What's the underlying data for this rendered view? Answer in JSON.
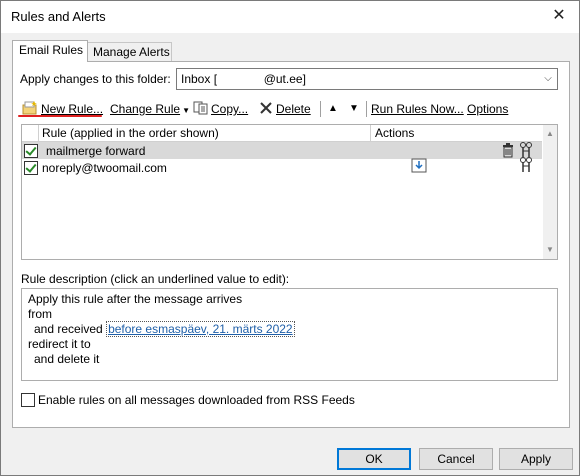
{
  "window": {
    "title": "Rules and Alerts",
    "close_glyph": "✕"
  },
  "tabs": [
    {
      "label": "Email Rules",
      "active": true
    },
    {
      "label": "Manage Alerts",
      "active": false
    }
  ],
  "folder": {
    "label": "Apply changes to this folder:",
    "value": "Inbox [              @ut.ee]"
  },
  "toolbar": {
    "new_rule": "New Rule...",
    "change_rule": "Change Rule",
    "copy": "Copy...",
    "delete": "Delete",
    "run_rules": "Run Rules Now...",
    "options": "Options"
  },
  "rules_table": {
    "columns": [
      "Rule (applied in the order shown)",
      "Actions"
    ],
    "rows": [
      {
        "name": "mailmerge forward",
        "enabled": true,
        "selected": true
      },
      {
        "name": "noreply@twoomail.com",
        "enabled": true,
        "selected": false
      }
    ]
  },
  "description": {
    "label": "Rule description (click an underlined value to edit):",
    "line1": "Apply this rule after the message arrives",
    "line2": "from",
    "line3_prefix": "and received",
    "line3_link": "before esmaspäev, 21. märts 2022",
    "line4": "redirect it to",
    "line5": "and delete it"
  },
  "rss": {
    "label": "Enable rules on all messages downloaded from RSS Feeds",
    "checked": false
  },
  "buttons": {
    "ok": "OK",
    "cancel": "Cancel",
    "apply": "Apply"
  },
  "colors": {
    "accent": "#0078d7",
    "highlight": "#e02020",
    "link": "#1f5fa8"
  }
}
